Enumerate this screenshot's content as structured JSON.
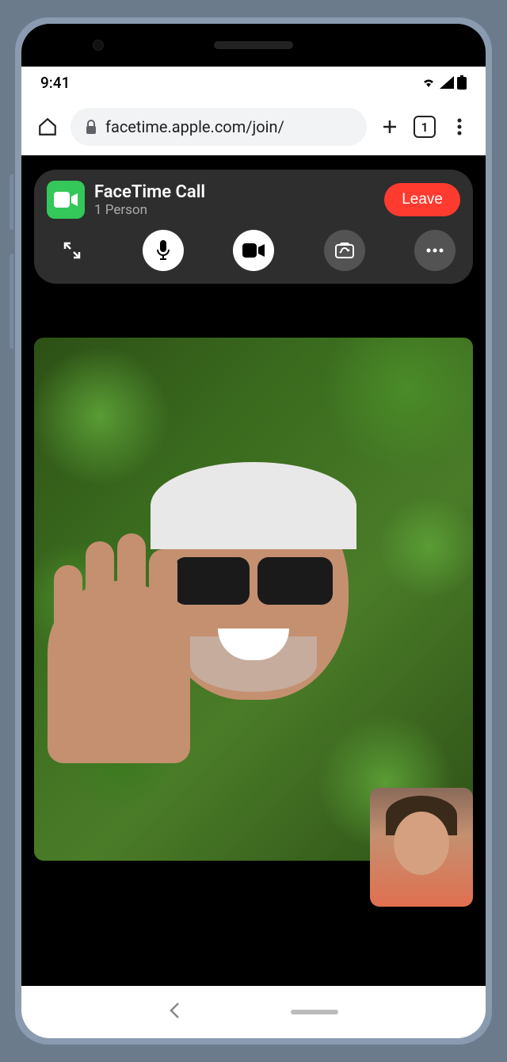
{
  "status_bar": {
    "time": "9:41"
  },
  "browser": {
    "url": "facetime.apple.com/join/",
    "tab_count": "1"
  },
  "call": {
    "app_name": "FaceTime Call",
    "participants": "1 Person",
    "leave_label": "Leave"
  }
}
